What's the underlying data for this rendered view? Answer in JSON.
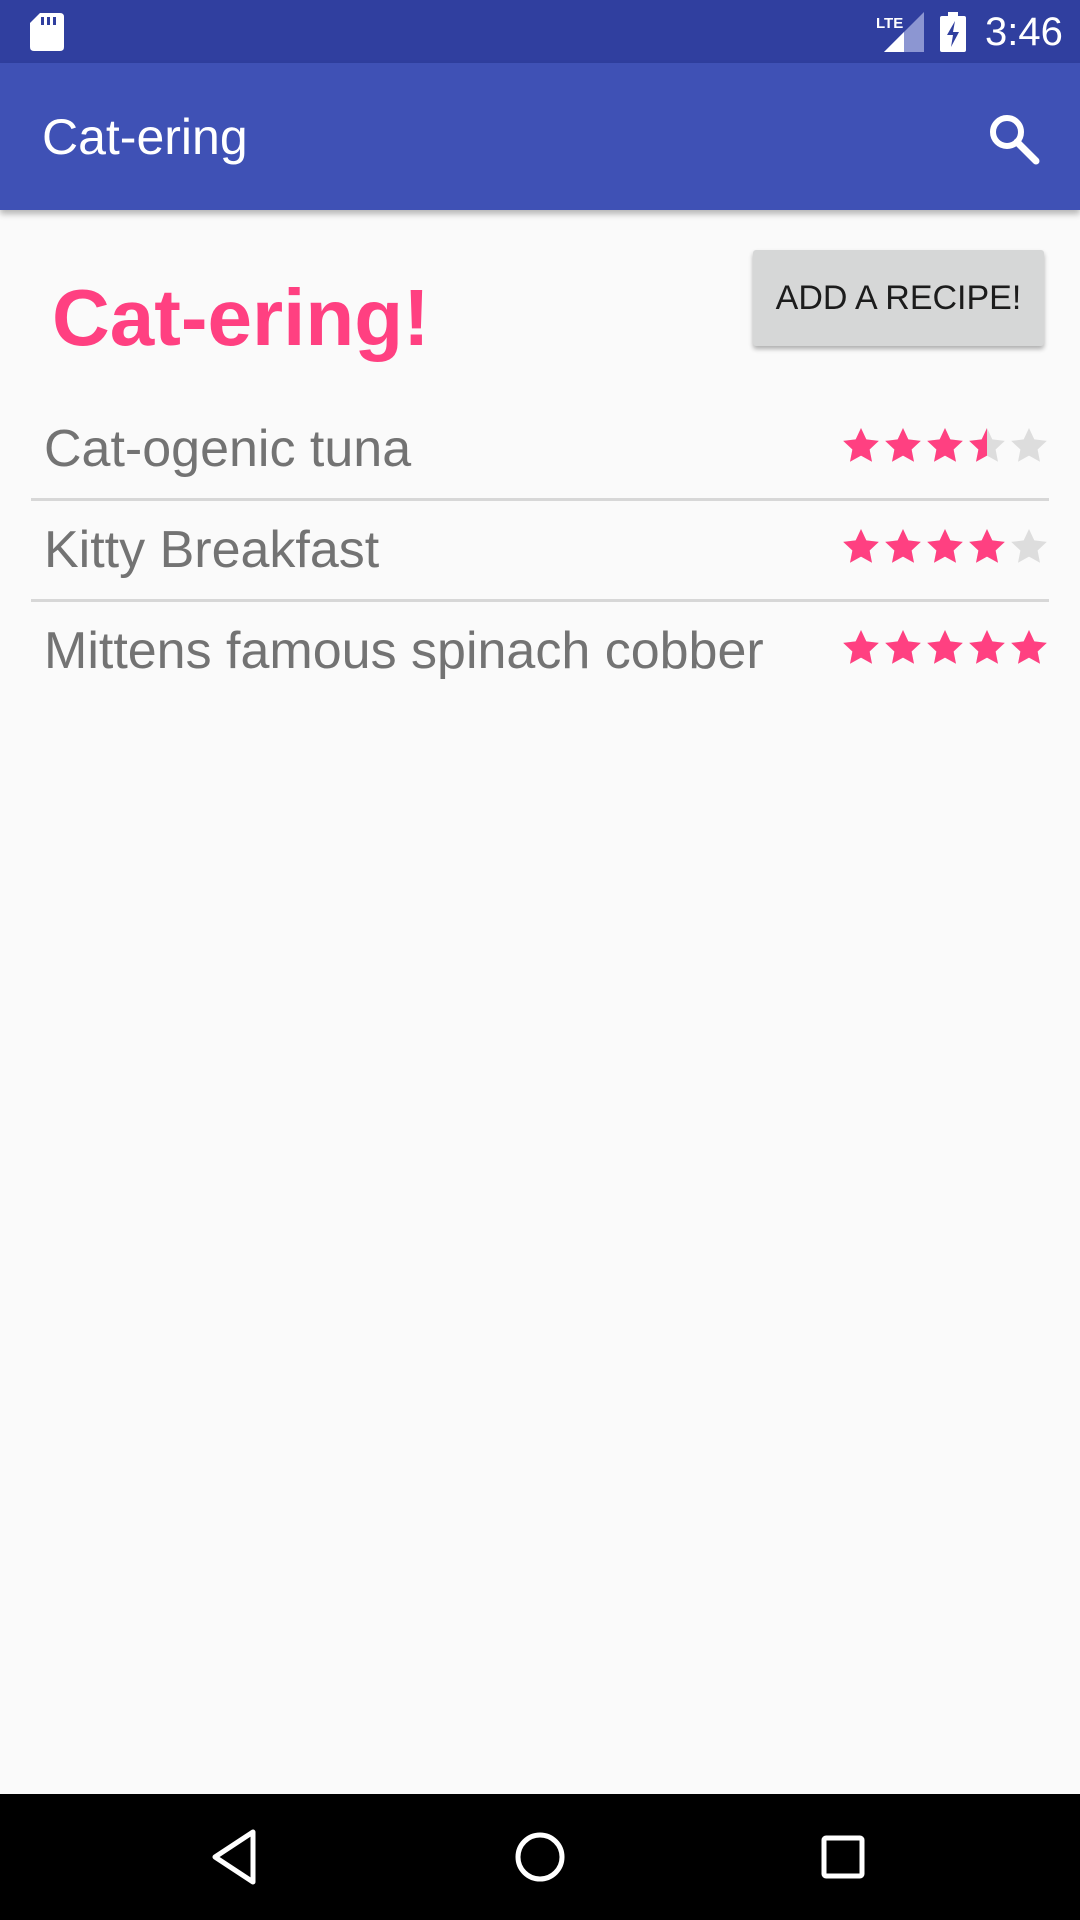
{
  "status_bar": {
    "time": "3:46",
    "network_label": "LTE",
    "icons": [
      "sd-card-icon",
      "lte-signal-icon",
      "battery-charging-icon"
    ]
  },
  "app_bar": {
    "title": "Cat-ering",
    "action_icon": "search-icon"
  },
  "main": {
    "heading": "Cat-ering!",
    "add_button_label": "ADD A RECIPE!",
    "recipes": [
      {
        "name": "Cat-ogenic tuna",
        "rating": 3.5,
        "max_rating": 5
      },
      {
        "name": "Kitty Breakfast",
        "rating": 4,
        "max_rating": 5
      },
      {
        "name": "Mittens famous spinach cobber",
        "rating": 5,
        "max_rating": 5
      }
    ]
  },
  "nav_bar": {
    "icons": [
      "back-icon",
      "home-icon",
      "recents-icon"
    ]
  },
  "colors": {
    "status_bar": "#303f9f",
    "app_bar": "#3f51b5",
    "accent": "#ff4081",
    "star_empty": "#dddddd",
    "background": "#fafafa"
  }
}
